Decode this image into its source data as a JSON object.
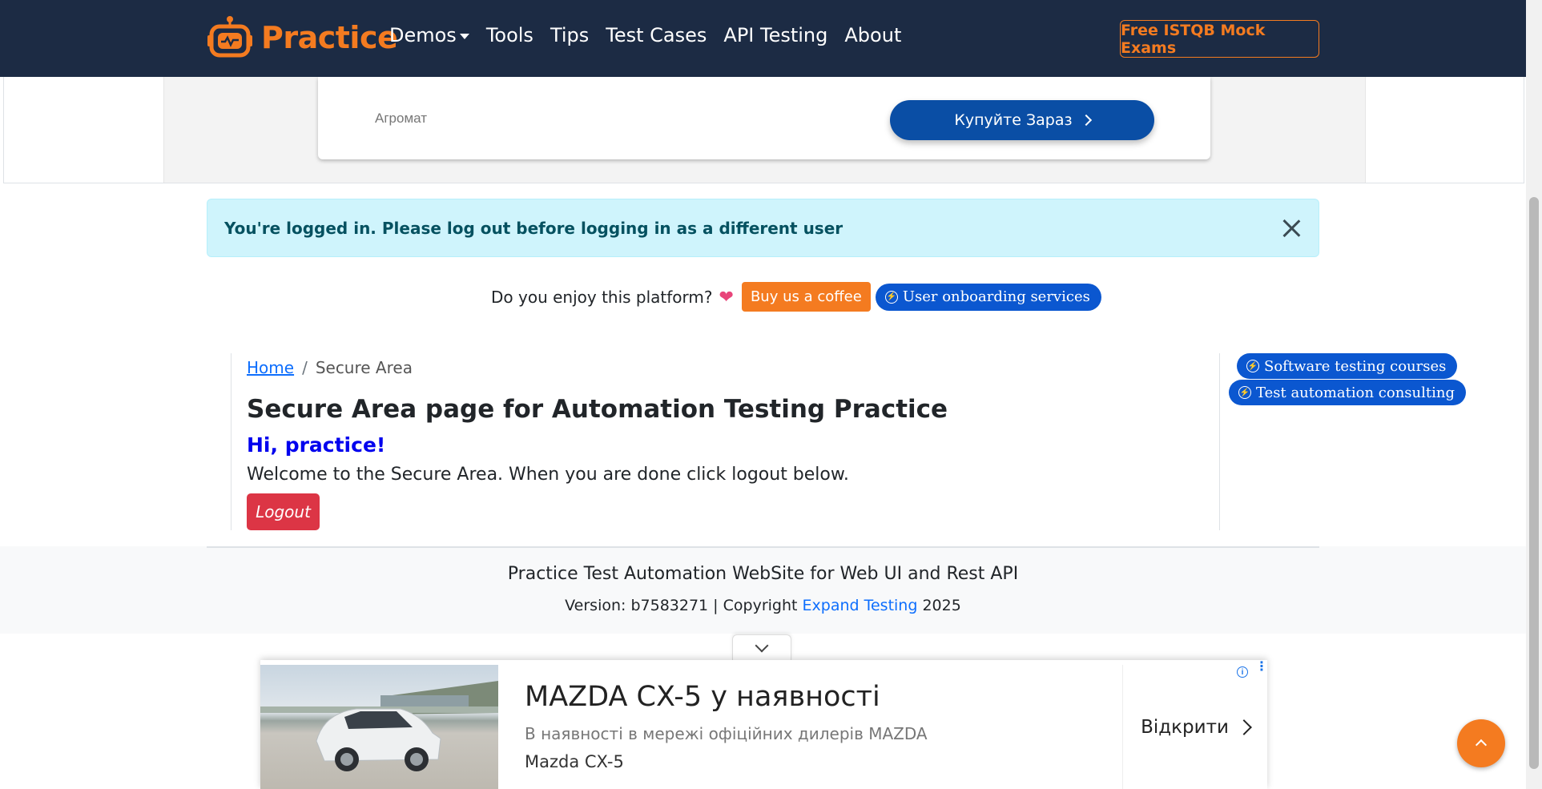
{
  "navbar": {
    "brand": "Practice",
    "links": [
      "Demos",
      "Tools",
      "Tips",
      "Test Cases",
      "API Testing",
      "About"
    ],
    "cta": "Free ISTQB Mock Exams",
    "brand_color": "#f47b20",
    "background": "#1c2b44"
  },
  "top_ad": {
    "advertiser": "Агромат",
    "button": "Купуйте Зараз"
  },
  "alert": {
    "text": "You're logged in. Please log out before logging in as a different user"
  },
  "support": {
    "question": "Do you enjoy this platform?",
    "heart": "❤",
    "coffee_button": "Buy us a coffee",
    "onboarding_button": "User onboarding services"
  },
  "breadcrumb": {
    "home": "Home",
    "separator": "/",
    "current": "Secure Area"
  },
  "main": {
    "title": "Secure Area page for Automation Testing Practice",
    "greeting": "Hi, practice!",
    "welcome": "Welcome to the Secure Area. When you are done click logout below.",
    "logout": "Logout"
  },
  "side_links": [
    "Software testing courses",
    "Test automation consulting"
  ],
  "footer": {
    "title": "Practice Test Automation WebSite for Web UI and Rest API",
    "version_prefix": "Version: b7583271 | Copyright",
    "company": "Expand Testing",
    "year": "2025"
  },
  "bottom_ad": {
    "title": "MAZDA CX-5 у наявності",
    "description": "В наявності в мережі офіційних дилерів MAZDA",
    "brand": "Mazda CX-5",
    "open": "Відкрити",
    "info": "i",
    "menu": "⋮"
  }
}
